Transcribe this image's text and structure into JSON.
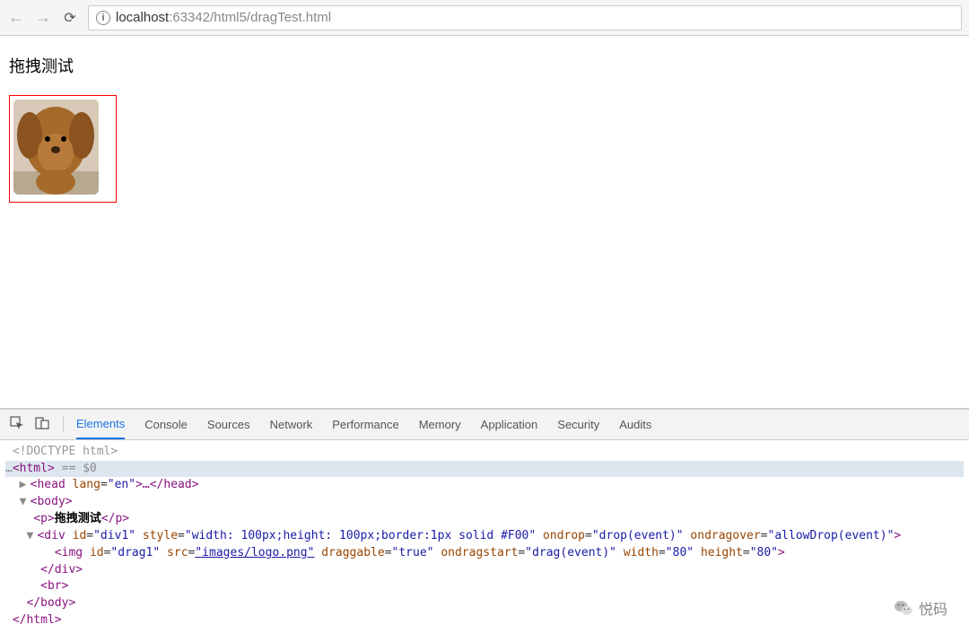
{
  "browser": {
    "url_host": "localhost",
    "url_rest": ":63342/html5/dragTest.html"
  },
  "page": {
    "title": "拖拽测试"
  },
  "devtools": {
    "tabs": [
      "Elements",
      "Console",
      "Sources",
      "Network",
      "Performance",
      "Memory",
      "Application",
      "Security",
      "Audits"
    ],
    "lines": {
      "l0": "<!DOCTYPE html>",
      "l1_open": "<html>",
      "l1_sel": " == $0",
      "l2_head_open": "<head ",
      "l2_head_attr": "lang",
      "l2_head_val": "\"en\"",
      "l2_head_mid": ">…</head>",
      "l3_body": "<body>",
      "l4_p_open": "<p>",
      "l4_p_text": "拖拽测试",
      "l4_p_close": "</p>",
      "l5_div_open": "<div ",
      "l5_id_name": "id",
      "l5_id_val": "\"div1\"",
      "l5_style_name": "style",
      "l5_style_val": "\"width: 100px;height: 100px;border:1px solid #F00\"",
      "l5_ondrop_name": "ondrop",
      "l5_ondrop_val": "\"drop(event)\"",
      "l5_ondragover_name": "ondragover",
      "l5_ondragover_val": "\"allowDrop(event)\"",
      "l5_close": ">",
      "l6_img_open": "<img ",
      "l6_id_name": "id",
      "l6_id_val": "\"drag1\"",
      "l6_src_name": "src",
      "l6_src_val": "\"images/logo.png\"",
      "l6_drag_name": "draggable",
      "l6_drag_val": "\"true\"",
      "l6_ondrag_name": "ondragstart",
      "l6_ondrag_val": "\"drag(event)\"",
      "l6_w_name": "width",
      "l6_w_val": "\"80\"",
      "l6_h_name": "height",
      "l6_h_val": "\"80\"",
      "l6_close": ">",
      "l7_div_close": "</div>",
      "l8_br": "<br>",
      "l9_body_close": "</body>",
      "l10_html_close": "</html>"
    }
  },
  "watermark": {
    "text": "悦码"
  }
}
